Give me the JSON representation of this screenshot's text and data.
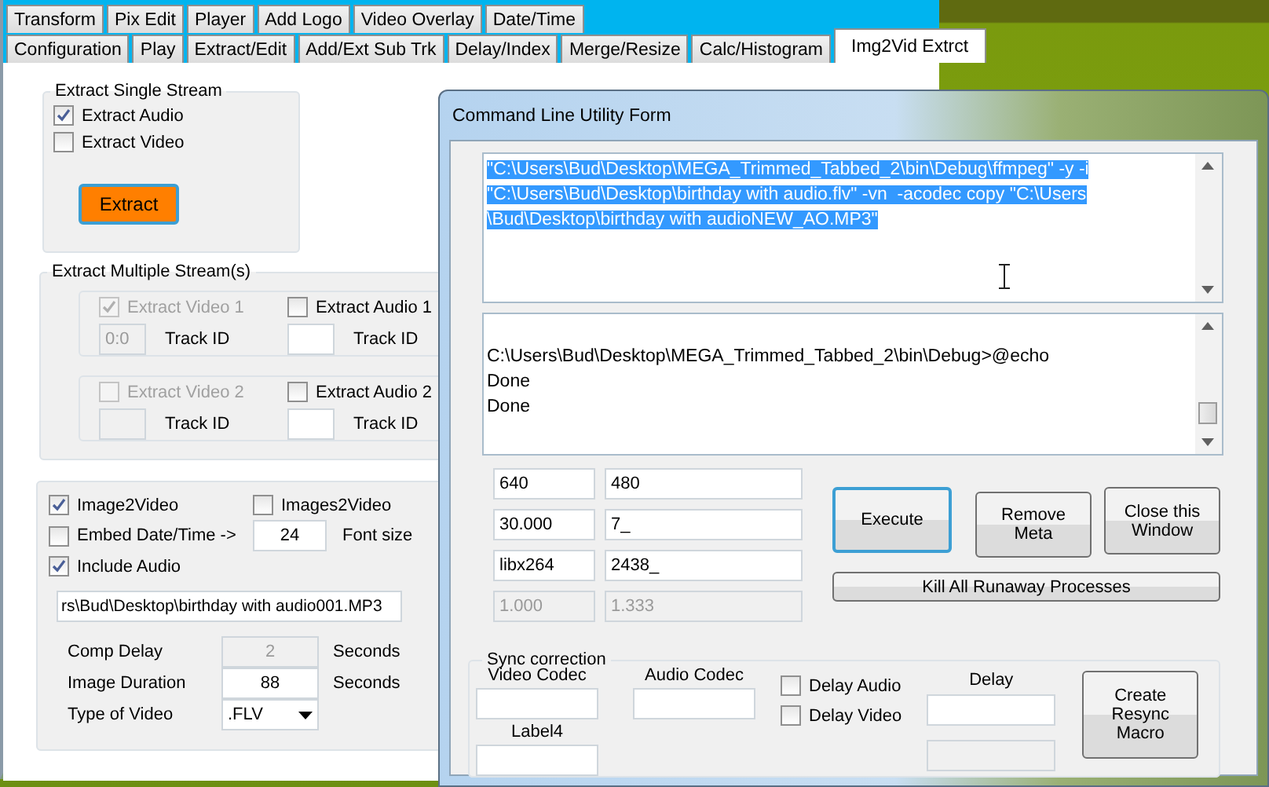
{
  "main_window": {
    "tab_rows": [
      [
        {
          "label": "Transform",
          "selected": false
        },
        {
          "label": "Pix Edit",
          "selected": false
        },
        {
          "label": "Player",
          "selected": false
        },
        {
          "label": "Add Logo",
          "selected": false
        },
        {
          "label": "Video Overlay",
          "selected": false
        },
        {
          "label": "Date/Time",
          "selected": false
        }
      ],
      [
        {
          "label": "Configuration",
          "selected": false
        },
        {
          "label": "Play",
          "selected": false
        },
        {
          "label": "Extract/Edit",
          "selected": false
        },
        {
          "label": "Add/Ext Sub Trk",
          "selected": false
        },
        {
          "label": "Delay/Index",
          "selected": false
        },
        {
          "label": "Merge/Resize",
          "selected": false
        },
        {
          "label": "Calc/Histogram",
          "selected": false
        },
        {
          "label": "Img2Vid Extrct",
          "selected": true
        }
      ]
    ],
    "single_stream": {
      "title": "Extract Single Stream",
      "checkboxes": [
        {
          "label": "Extract Audio",
          "checked": true
        },
        {
          "label": "Extract Video",
          "checked": false
        }
      ],
      "button": {
        "label": "Extract",
        "focused": true
      }
    },
    "multiple_streams": {
      "title": "Extract Multiple Stream(s)",
      "groups": [
        {
          "video": {
            "label": "Extract Video 1",
            "checked": true,
            "disabled": true
          },
          "video_track": {
            "value": "0:0",
            "disabled": true
          },
          "video_track_label": "Track ID",
          "audio": {
            "label": "Extract Audio 1",
            "checked": false,
            "disabled": false
          },
          "audio_track": {
            "disabled": false
          },
          "audio_track_label": "Track ID"
        },
        {
          "video": {
            "label": "Extract Video 2",
            "checked": false,
            "disabled": true
          },
          "video_track": {
            "disabled": true
          },
          "video_track_label": "Track ID",
          "audio": {
            "label": "Extract Audio 2",
            "checked": false,
            "disabled": false
          },
          "audio_track": {
            "disabled": false
          },
          "audio_track_label": "Track ID"
        }
      ]
    },
    "image2video": {
      "image2video": {
        "label": "Image2Video",
        "checked": true
      },
      "images2video": {
        "label": "Images2Video",
        "checked": false
      },
      "embed_datetime": {
        "label": "Embed Date/Time ->",
        "checked": false
      },
      "font_size": {
        "value": "24",
        "label": "Font size"
      },
      "include_audio": {
        "label": "Include Audio",
        "checked": true
      },
      "audio_path": "rs\\Bud\\Desktop\\birthday with audio001.MP3",
      "rows": [
        {
          "label": "Comp Delay",
          "kind": "field",
          "value": "2",
          "disabled": true,
          "unit": "Seconds"
        },
        {
          "label": "Image Duration",
          "kind": "field",
          "value": "88",
          "disabled": false,
          "unit": "Seconds"
        },
        {
          "label": "Type of Video",
          "kind": "dropdown",
          "value": ".FLV"
        }
      ]
    }
  },
  "dialog": {
    "title": "Command Line Utility Form",
    "command_lines": [
      "\"C:\\Users\\Bud\\Desktop\\MEGA_Trimmed_Tabbed_2\\bin\\Debug\\ffmpeg\" -y -i",
      "\"C:\\Users\\Bud\\Desktop\\birthday with audio.flv\" -vn  -acodec copy \"C:\\Users",
      "\\Bud\\Desktop\\birthday with audioNEW_AO.MP3\""
    ],
    "output_lines": [
      "C:\\Users\\Bud\\Desktop\\MEGA_Trimmed_Tabbed_2\\bin\\Debug>@echo",
      "Done",
      "Done"
    ],
    "fields": [
      {
        "value": "640",
        "disabled": false
      },
      {
        "value": "480",
        "disabled": false
      },
      {
        "value": "30.000",
        "disabled": false
      },
      {
        "value": "7_",
        "disabled": false
      },
      {
        "value": "libx264",
        "disabled": false
      },
      {
        "value": "2438_",
        "disabled": false
      },
      {
        "value": "1.000",
        "disabled": true
      },
      {
        "value": "1.333",
        "disabled": true
      }
    ],
    "buttons": [
      {
        "label": "Execute",
        "focused": true
      },
      {
        "label": "Remove Meta",
        "focused": false
      },
      {
        "label": "Close this Window",
        "focused": false
      }
    ],
    "kill_button": "Kill All Runaway Processes",
    "sync": {
      "title": "Sync correction",
      "video_codec_label": "Video Codec",
      "audio_codec_label": "Audio Codec",
      "label4": "Label4",
      "delay_label": "Delay",
      "checkboxes": [
        {
          "label": "Delay Audio",
          "checked": false
        },
        {
          "label": "Delay Video",
          "checked": false
        }
      ],
      "button": "Create Resync Macro"
    }
  }
}
